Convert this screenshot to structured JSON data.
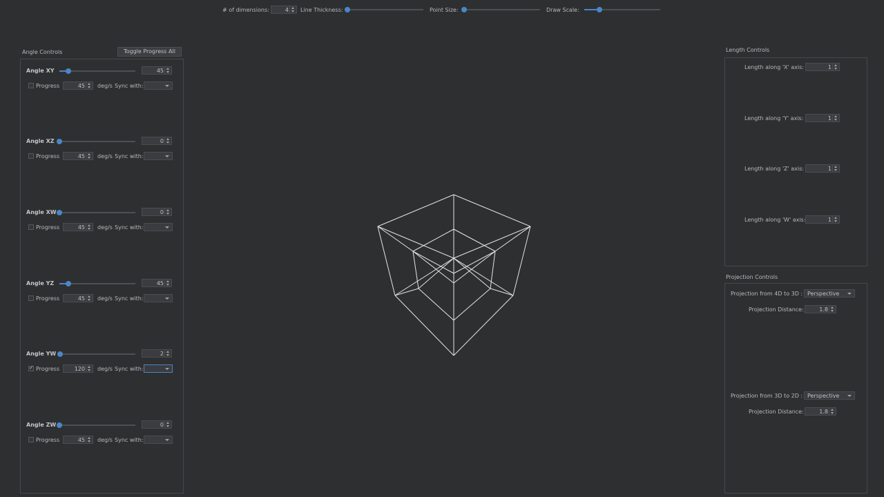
{
  "toolbar": {
    "dims_label": "# of dimensions:",
    "dims_value": "4",
    "line_label": "Line Thickness:",
    "point_label": "Point Size:",
    "scale_label": "Draw Scale:",
    "line_level": 0.0,
    "point_level": 0.0,
    "scale_level": 0.2
  },
  "angle_panel": {
    "title": "Angle Controls",
    "toggle_label": "Toggle Progress All",
    "rows": [
      {
        "name": "Angle XY",
        "value": "45",
        "level": 0.12,
        "progress": "Progress",
        "speed": "45",
        "unit": "deg/s",
        "sync": "Sync with:",
        "checked": false
      },
      {
        "name": "Angle XZ",
        "value": "0",
        "level": 0.0,
        "progress": "Progress",
        "speed": "45",
        "unit": "deg/s",
        "sync": "Sync with:",
        "checked": false
      },
      {
        "name": "Angle XW",
        "value": "0",
        "level": 0.0,
        "progress": "Progress",
        "speed": "45",
        "unit": "deg/s",
        "sync": "Sync with:",
        "checked": false
      },
      {
        "name": "Angle YZ",
        "value": "45",
        "level": 0.12,
        "progress": "Progress",
        "speed": "45",
        "unit": "deg/s",
        "sync": "Sync with:",
        "checked": false
      },
      {
        "name": "Angle YW",
        "value": "2",
        "level": 0.01,
        "progress": "Progress",
        "speed": "120",
        "unit": "deg/s",
        "sync": "Sync with:",
        "checked": true
      },
      {
        "name": "Angle ZW",
        "value": "0",
        "level": 0.0,
        "progress": "Progress",
        "speed": "45",
        "unit": "deg/s",
        "sync": "Sync with:",
        "checked": false
      }
    ]
  },
  "length_panel": {
    "title": "Length Controls",
    "rows": [
      {
        "label": "Length along 'X' axis:",
        "value": "1"
      },
      {
        "label": "Length along 'Y' axis:",
        "value": "1"
      },
      {
        "label": "Length along 'Z' axis:",
        "value": "1"
      },
      {
        "label": "Length along 'W' axis:",
        "value": "1"
      }
    ]
  },
  "projection_panel": {
    "title": "Projection Controls",
    "p43_label": "Projection from 4D to 3D :",
    "p43_value": "Perspective",
    "p43_dist_label": "Projection Distance:",
    "p43_dist_value": "1.8",
    "p32_label": "Projection from 3D to 2D :",
    "p32_value": "Perspective",
    "p32_dist_label": "Projection Distance:",
    "p32_dist_value": "1.8"
  },
  "colors": {
    "background": "#2e2f31",
    "accent": "#4a86c8",
    "wireframe": "#e6e6e6"
  }
}
